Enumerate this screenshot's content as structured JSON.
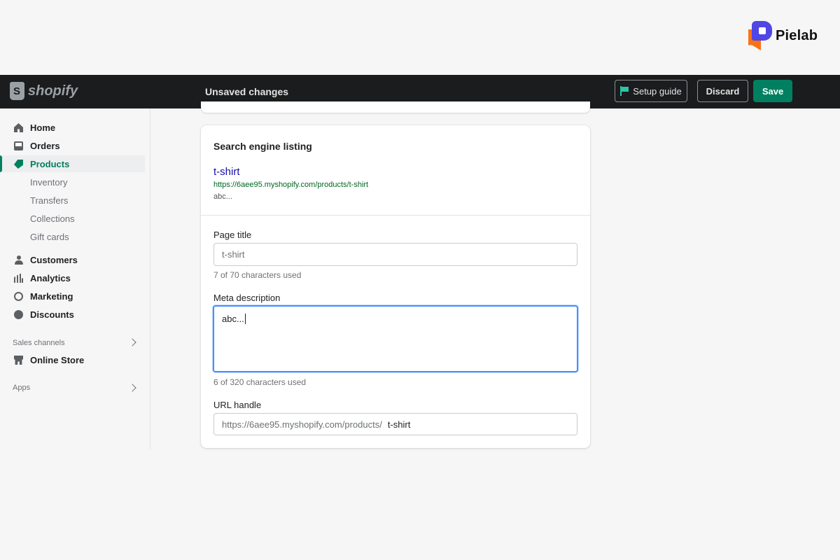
{
  "brand": {
    "name": "Pielab"
  },
  "topbar": {
    "logo_text": "shopify",
    "title": "Unsaved changes",
    "setup_guide_label": "Setup guide",
    "discard_label": "Discard",
    "save_label": "Save",
    "accent_color": "#008060"
  },
  "sidebar": {
    "items": [
      {
        "label": "Home",
        "icon": "home-icon"
      },
      {
        "label": "Orders",
        "icon": "orders-icon"
      },
      {
        "label": "Products",
        "icon": "tag-icon",
        "active": true
      },
      {
        "label": "Customers",
        "icon": "customers-icon"
      },
      {
        "label": "Analytics",
        "icon": "analytics-icon"
      },
      {
        "label": "Marketing",
        "icon": "marketing-icon"
      },
      {
        "label": "Discounts",
        "icon": "discounts-icon"
      }
    ],
    "product_subitems": [
      "Inventory",
      "Transfers",
      "Collections",
      "Gift cards"
    ],
    "sales_channels_label": "Sales channels",
    "online_store_label": "Online Store",
    "apps_label": "Apps"
  },
  "seo": {
    "title": "Search engine listing",
    "preview": {
      "title": "t-shirt",
      "url": "https://6aee95.myshopify.com/products/t-shirt",
      "description": "abc..."
    },
    "page_title": {
      "label": "Page title",
      "value": "t-shirt",
      "help": "7 of 70 characters used"
    },
    "meta_description": {
      "label": "Meta description",
      "value": "abc...",
      "help": "6 of 320 characters used"
    },
    "url_handle": {
      "label": "URL handle",
      "prefix": "https://6aee95.myshopify.com/products/",
      "value": "t-shirt"
    }
  }
}
